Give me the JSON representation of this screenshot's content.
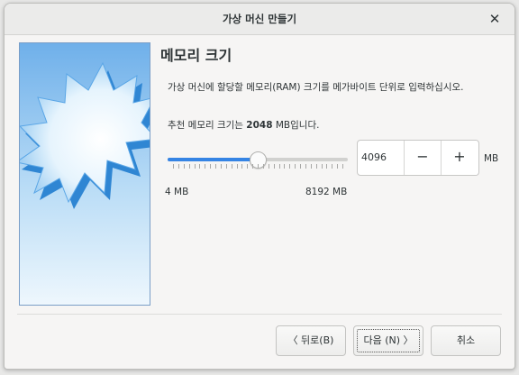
{
  "window": {
    "title": "가상 머신 만들기",
    "close_glyph": "✕"
  },
  "page": {
    "heading": "메모리 크기",
    "description": "가상 머신에 할당할 메모리(RAM) 크기를 메가바이트 단위로 입력하십시오.",
    "recommend_prefix": "추천 메모리 크기는 ",
    "recommend_value": "2048",
    "recommend_suffix": " MB입니다."
  },
  "memory": {
    "slider_fraction": 0.4996,
    "min_label": "4 MB",
    "max_label": "8192 MB",
    "value": "4096",
    "unit": "MB",
    "minus_label": "−",
    "plus_label": "+",
    "tick_count": 33
  },
  "buttons": {
    "back": "〈 뒤로(B)",
    "next": "다음 (N) 〉",
    "cancel": "취소"
  },
  "colors": {
    "accent": "#3584e4",
    "window_bg": "#f6f5f4",
    "image_border": "#7a9ec7"
  }
}
